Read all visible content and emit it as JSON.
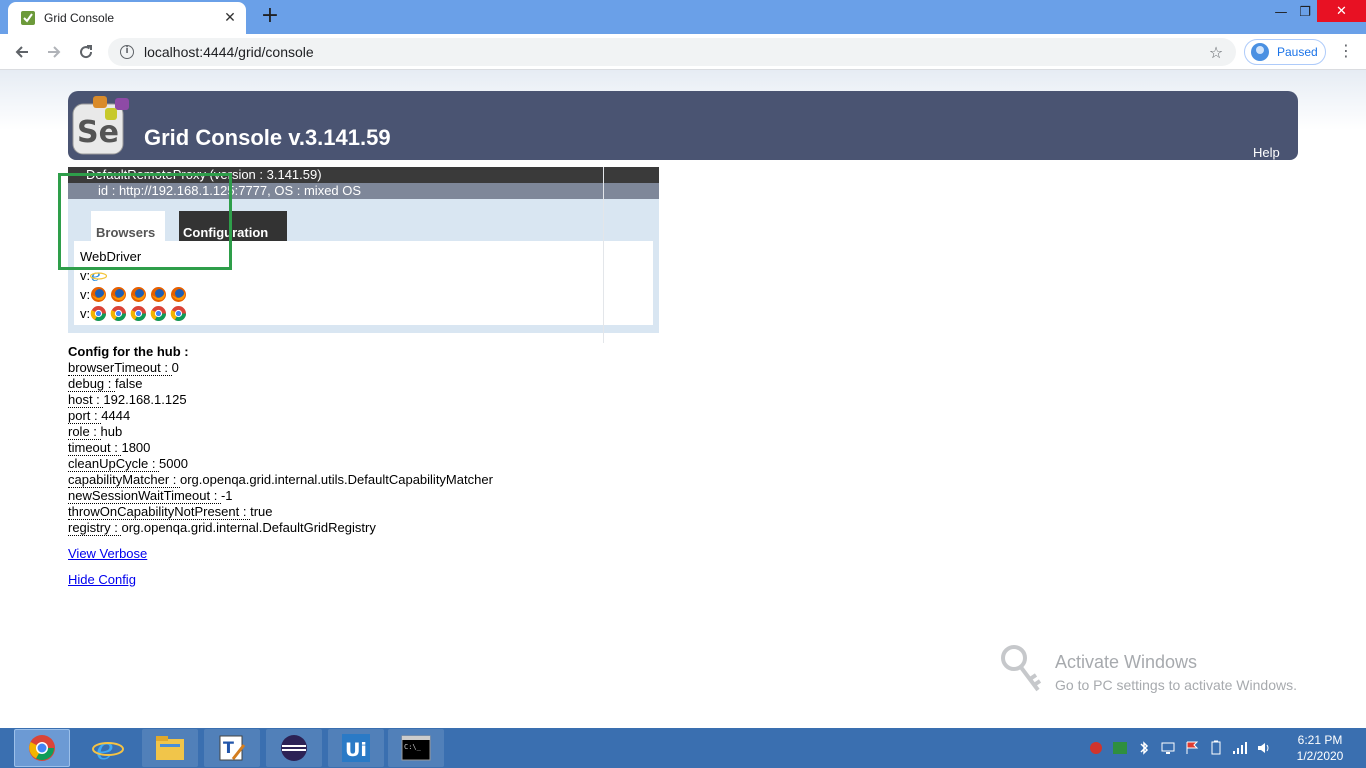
{
  "browser": {
    "tab_title": "Grid Console",
    "tab_close": "✕",
    "new_tab": "+",
    "url": "localhost:4444/grid/console",
    "profile_label": "Paused",
    "window_controls": {
      "minimize": "—",
      "maximize": "❐",
      "close": "✕"
    }
  },
  "header": {
    "title": "Grid Console v.3.141.59",
    "help": "Help"
  },
  "proxy": {
    "name": "DefaultRemoteProxy (version : 3.141.59)",
    "id": "id : http://192.168.1.125:7777, OS : mixed OS",
    "tabs": {
      "browsers": "Browsers",
      "configuration": "Configuration"
    },
    "protocol": "WebDriver",
    "version_prefix": "v:",
    "rows": [
      {
        "browser": "internet-explorer",
        "count": 1
      },
      {
        "browser": "firefox",
        "count": 5
      },
      {
        "browser": "chrome",
        "count": 5
      }
    ]
  },
  "config": {
    "heading": "Config for the hub :",
    "entries": [
      {
        "key": "browserTimeout : ",
        "value": "0"
      },
      {
        "key": "debug : ",
        "value": "false"
      },
      {
        "key": "host : ",
        "value": "192.168.1.125"
      },
      {
        "key": "port : ",
        "value": "4444"
      },
      {
        "key": "role : ",
        "value": "hub"
      },
      {
        "key": "timeout : ",
        "value": "1800"
      },
      {
        "key": "cleanUpCycle : ",
        "value": "5000"
      },
      {
        "key": "capabilityMatcher : ",
        "value": "org.openqa.grid.internal.utils.DefaultCapabilityMatcher"
      },
      {
        "key": "newSessionWaitTimeout : ",
        "value": "-1"
      },
      {
        "key": "throwOnCapabilityNotPresent : ",
        "value": "true"
      },
      {
        "key": "registry : ",
        "value": "org.openqa.grid.internal.DefaultGridRegistry"
      }
    ]
  },
  "links": {
    "view_verbose": "View Verbose",
    "hide_config": "Hide Config"
  },
  "watermark": {
    "title": "Activate Windows",
    "subtitle": "Go to PC settings to activate Windows."
  },
  "taskbar": {
    "apps": [
      "chrome-icon",
      "internet-explorer-icon",
      "file-explorer-icon",
      "text-editor-icon",
      "eclipse-icon",
      "uipath-icon",
      "command-prompt-icon"
    ],
    "clock_time": "6:21 PM",
    "clock_date": "1/2/2020"
  },
  "colors": {
    "banner": "#4a5472",
    "highlight": "#2e9e4a",
    "taskbar": "#3a6fb0"
  }
}
